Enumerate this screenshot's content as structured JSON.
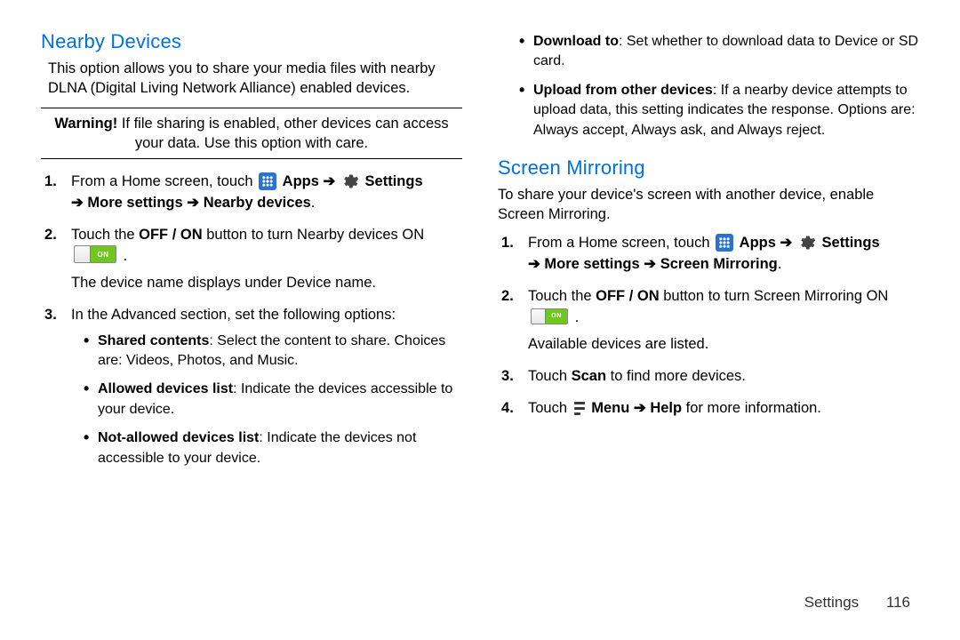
{
  "left": {
    "title": "Nearby Devices",
    "intro": "This option allows you to share your media files with nearby DLNA (Digital Living Network Alliance) enabled devices.",
    "warning_label": "Warning!",
    "warning_text": " If file sharing is enabled, other devices can access your data. Use this option with care.",
    "step1": {
      "prefix": "From a Home screen, touch ",
      "apps": " Apps ",
      "arrow1": "➔ ",
      "settings": " Settings ",
      "line2_arrow": "➔ ",
      "line2_a": "More settings",
      "line2_arrow2": " ➔ ",
      "line2_b": "Nearby devices",
      "line2_period": "."
    },
    "step2": {
      "a": "Touch the ",
      "offon": "OFF / ON",
      "b": " button to turn Nearby devices ON ",
      "on_text": "ON",
      "period": ".",
      "sub": "The device name displays under Device name."
    },
    "step3": {
      "lead": "In the Advanced section, set the following options:",
      "bullets": [
        {
          "label": "Shared contents",
          "text": ": Select the content to share. Choices are: Videos, Photos, and Music."
        },
        {
          "label": "Allowed devices list",
          "text": ": Indicate the devices accessible to your device."
        },
        {
          "label": "Not-allowed devices list",
          "text": ": Indicate the devices not accessible to your device."
        }
      ]
    }
  },
  "right": {
    "top_bullets": [
      {
        "label": "Download to",
        "text": ": Set whether to download data to Device or SD card."
      },
      {
        "label": "Upload from other devices",
        "text": ": If a nearby device attempts to upload data, this setting indicates the response. Options are: Always accept, Always ask, and Always reject."
      }
    ],
    "title": "Screen Mirroring",
    "intro": "To share your device's screen with another device, enable Screen Mirroring.",
    "step1": {
      "prefix": "From a Home screen, touch ",
      "apps": " Apps ",
      "arrow1": "➔ ",
      "settings": " Settings ",
      "line2_arrow": "➔ ",
      "line2_a": "More settings",
      "line2_arrow2": " ➔ ",
      "line2_b": "Screen Mirroring",
      "line2_period": "."
    },
    "step2": {
      "a": "Touch the ",
      "offon": "OFF / ON",
      "b": " button to turn Screen Mirroring ON ",
      "on_text": "ON",
      "period": ".",
      "sub": "Available devices are listed."
    },
    "step3": {
      "a": "Touch ",
      "scan": "Scan",
      "b": " to find more devices."
    },
    "step4": {
      "a": "Touch ",
      "menu": " Menu ",
      "arrow": "➔ ",
      "help": "Help",
      "b": " for more information."
    }
  },
  "footer": {
    "section": "Settings",
    "page": "116"
  }
}
